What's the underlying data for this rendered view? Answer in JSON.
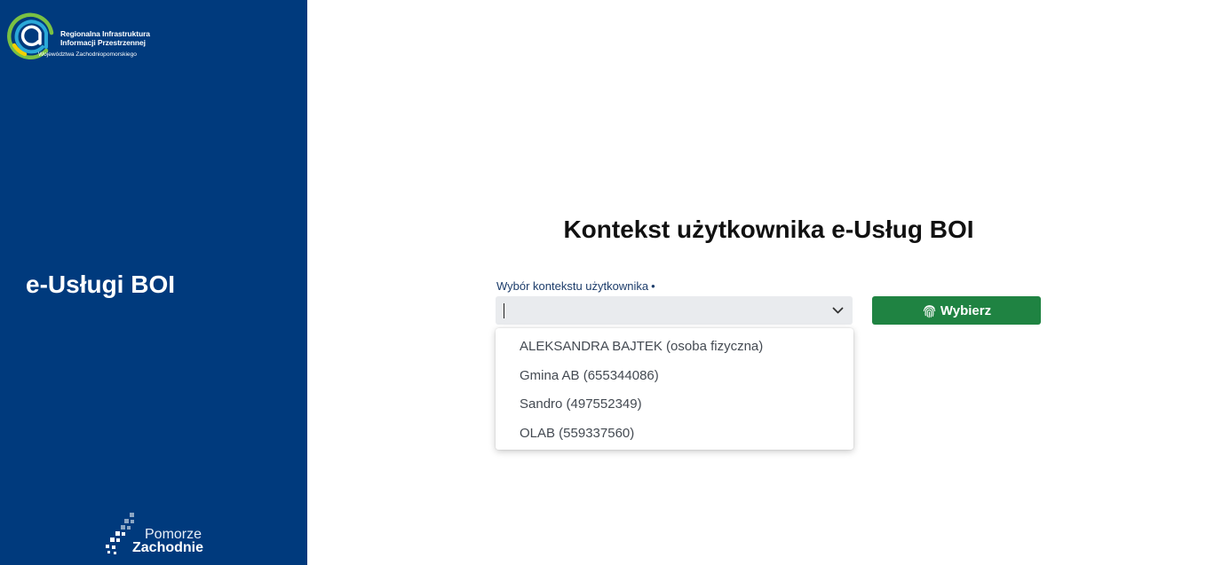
{
  "sidebar": {
    "logo_top": {
      "line1": "Regionalna Infrastruktura",
      "line2": "Informacji Przestrzennej",
      "line3": "Województwa Zachodniopomorskiego",
      "colors": {
        "outer_ring": "#7ac143",
        "middle_ring": "#2aa8d8",
        "inner_ring": "#ffffff",
        "accent": "#f4d000"
      }
    },
    "title": "e-Usługi BOI",
    "logo_bottom": {
      "line1": "Pomorze",
      "line2": "Zachodnie"
    },
    "background": "#003a7d"
  },
  "main": {
    "title": "Kontekst użytkownika e-Usług BOI",
    "context_field": {
      "label": "Wybór kontekstu użytkownika",
      "required_mark": "•",
      "value": "",
      "chevron_icon": "chevron-down-icon"
    },
    "submit_button": {
      "label": "Wybierz",
      "icon": "fingerprint-icon",
      "color": "#1f8342"
    },
    "dropdown_options": [
      "ALEKSANDRA BAJTEK (osoba fizyczna)",
      "Gmina AB (655344086)",
      "Sandro (497552349)",
      "OLAB (559337560)"
    ]
  }
}
